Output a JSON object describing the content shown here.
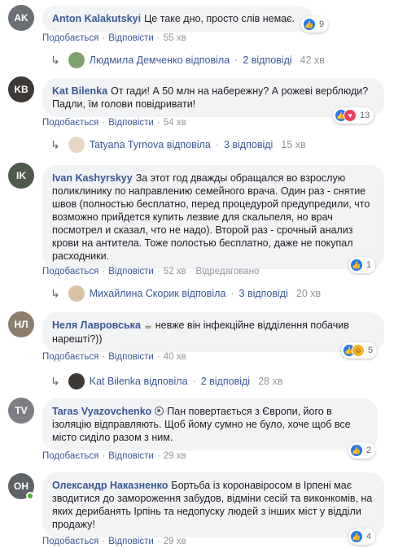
{
  "labels": {
    "like": "Подобається",
    "reply": "Відповісти",
    "edited": "Відредаговано",
    "dot": "·"
  },
  "comments": [
    {
      "author": "Anton Kalakutskyi",
      "text": "Це таке дно, просто слів немає.",
      "reactions": "9",
      "time": "55 хв",
      "reply": {
        "name": "Людмила Демченко відповіла",
        "count": "2 відповіді",
        "time": "42 хв"
      }
    },
    {
      "author": "Kat Bilenka",
      "text": "От гади! А 50 млн на набережну? А рожеві верблюди? Падли, їм голови повідривати!",
      "reactions": "13",
      "time": "54 хв",
      "reply": {
        "name": "Tatyana Tyrnova відповіла",
        "count": "3 відповіді",
        "time": "15 хв"
      }
    },
    {
      "author": "Ivan Kashyrskyy",
      "text": "За этот год дважды обращался во взрослую поликлинику по направлению семейного врача. Один раз - снятие швов (полностью бесплатно, перед процедурой предупредили, что возможно прийдется купить лезвие для скальпеля, но врач посмотрел и сказал, что не надо). Второй раз - срочный анализ крови на антитела. Тоже полостью бесплатно, даже не покупал расходники.",
      "reactions": "1",
      "time": "52 хв",
      "reply": {
        "name": "Михайлина Скорик відповіла",
        "count": "3 відповіді",
        "time": "20 хв"
      }
    },
    {
      "author": "Неля Лавровська",
      "text": "невже він інфекційне відділення побачив нарешті?))",
      "reactions": "5",
      "time": "40 хв",
      "reply": {
        "name": "Kat Bilenka відповіла",
        "count": "2 відповіді",
        "time": "28 хв"
      }
    },
    {
      "author": "Taras Vyazovchenko",
      "text": "Пан повертається з Європи, його в ізоляцію відправляють. Щоб йому сумно не було, хоче щоб все місто сиділо разом з ним.",
      "reactions": "2",
      "time": "29 хв"
    },
    {
      "author": "Олександр Наказненко",
      "text": "Бортьба із коронавіросом в Ірпені має зводитися до замороження забудов, відміни сесій та виконкомів, на яких дерибанять Ірпінь та недопуску людей з інших міст у відділи продажу!",
      "reactions": "4",
      "time": "29 хв"
    }
  ],
  "colors": {
    "link": "#385898",
    "bubble": "#f2f3f5",
    "meta": "#90949c",
    "like": "#2078f4",
    "love": "#f33e58",
    "haha": "#f7b125"
  }
}
